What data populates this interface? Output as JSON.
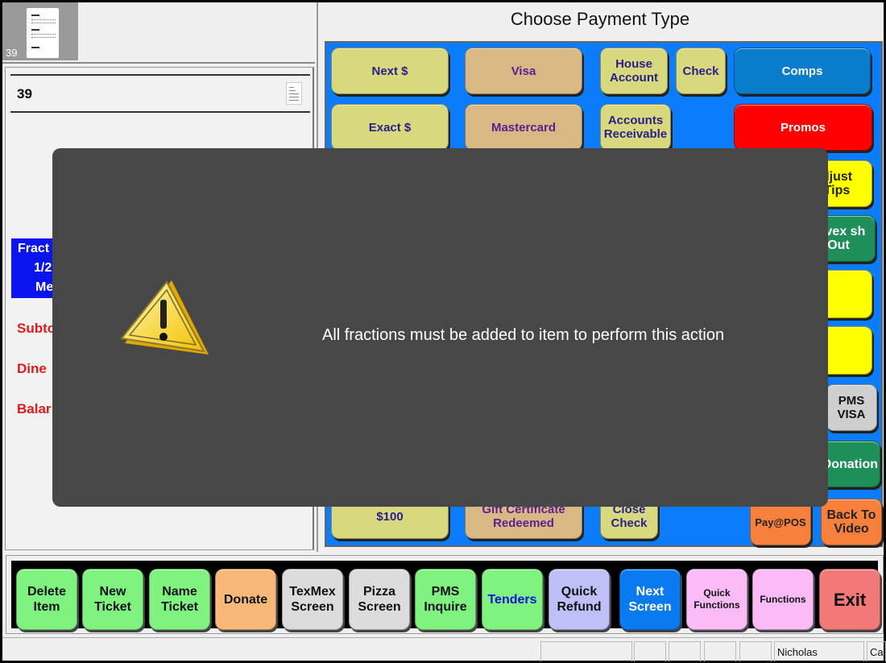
{
  "left_panel": {
    "thumbnail_number": "39",
    "ticket_number": "39",
    "fraction_lines": [
      "Fract",
      "1/2",
      "Me"
    ],
    "totals": [
      "Subto",
      "Dine",
      "Balar"
    ]
  },
  "payment": {
    "title": "Choose Payment Type",
    "buttons": {
      "next": "Next $",
      "visa": "Visa",
      "house_account": "House Account",
      "check": "Check",
      "comps": "Comps",
      "exact": "Exact $",
      "mastercard": "Mastercard",
      "accounts_receivable": "Accounts Receivable",
      "promos": "Promos",
      "adjust_tips": "djust Tips",
      "givex_cash_out": "Givex sh Out",
      "pms_visa": "PMS VISA",
      "donation": "Donation",
      "hundred": "$100",
      "gift_certificate": "Gift Certificate Redeemed",
      "close_check": "Close Check",
      "pay_at_pos": "Pay@POS",
      "back_to_video": "Back To Video"
    }
  },
  "toolbar": {
    "buttons": [
      {
        "label": "Delete Item"
      },
      {
        "label": "New Ticket"
      },
      {
        "label": "Name Ticket"
      },
      {
        "label": "Donate"
      },
      {
        "label": "TexMex Screen"
      },
      {
        "label": "Pizza Screen"
      },
      {
        "label": "PMS Inquire"
      },
      {
        "label": "Tenders"
      },
      {
        "label": "Quick Refund"
      },
      {
        "label": "Next Screen"
      },
      {
        "label": "Quick Functions"
      },
      {
        "label": "Functions"
      },
      {
        "label": "Exit"
      }
    ]
  },
  "statusbar": {
    "user": "Nicholas",
    "trailing": "Ca"
  },
  "modal": {
    "icon": "warning-icon",
    "message": "All fractions must be added to item to perform this action"
  },
  "colors": {
    "payment_bg": "#0b7dfb",
    "modal_bg": "#474747",
    "fraction_bg": "#0a14ee",
    "total_text": "#e21a1a"
  }
}
